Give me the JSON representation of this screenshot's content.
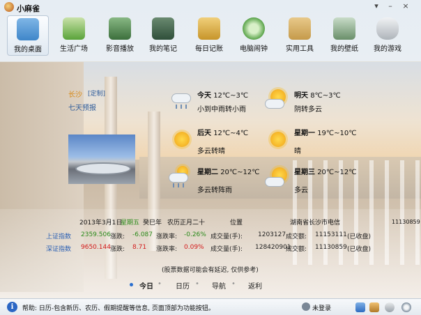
{
  "app": {
    "title": "小麻雀"
  },
  "window_buttons": [
    "▾",
    "–",
    "×"
  ],
  "toolbar": [
    {
      "label": "我的桌面",
      "icon": "house-icon",
      "color": "#3f86c9",
      "active": true
    },
    {
      "label": "生活广场",
      "icon": "village-icon",
      "color": "#5aa33a"
    },
    {
      "label": "影音播放",
      "icon": "film-reel-icon",
      "color": "#3c6f3c"
    },
    {
      "label": "我的笔记",
      "icon": "notebook-icon",
      "color": "#2f4f3a"
    },
    {
      "label": "每日记账",
      "icon": "ledger-dollar-icon",
      "color": "#c7952a"
    },
    {
      "label": "电脑闹钟",
      "icon": "alarm-clock-icon",
      "color": "#4a9a3a"
    },
    {
      "label": "实用工具",
      "icon": "toolbox-icon",
      "color": "#c59a4a"
    },
    {
      "label": "我的壁纸",
      "icon": "wallpaper-icon",
      "color": "#6a8f6a"
    },
    {
      "label": "我的游戏",
      "icon": "gamepad-icon",
      "color": "#aeb4ba"
    }
  ],
  "weather": {
    "city": "长沙",
    "customize": "[定制]",
    "seven_day": "七天预报",
    "forecasts": [
      {
        "day": "今天",
        "temp": "12℃~3℃",
        "desc": "小到中雨转小雨",
        "icon": "rain-icon"
      },
      {
        "day": "明天",
        "temp": "8℃~3℃",
        "desc": "阴转多云",
        "icon": "cloud-sun-icon"
      },
      {
        "day": "后天",
        "temp": "12℃~4℃",
        "desc": "多云转晴",
        "icon": "sun-icon"
      },
      {
        "day": "星期一",
        "temp": "19℃~10℃",
        "desc": "晴",
        "icon": "sun-icon"
      },
      {
        "day": "星期二",
        "temp": "20℃~12℃",
        "desc": "多云转阵雨",
        "icon": "cloud-rain-icon"
      },
      {
        "day": "星期三",
        "temp": "20℃~12℃",
        "desc": "多云",
        "icon": "cloud-sun-icon"
      }
    ]
  },
  "date_row": {
    "date": "2013年3月1日",
    "weekday": "星期五",
    "ganzhi": "癸巳年",
    "lunar": "农历正月二十",
    "location_label": "位置",
    "location": "湖南省长沙市电信",
    "number": "11130859"
  },
  "stocks": [
    {
      "name": "上证指数",
      "value": "2359.506",
      "change_label": "涨跌:",
      "change": "-6.087",
      "rate_label": "涨跌率:",
      "rate": "-0.26%",
      "volume_label": "成交量(手):",
      "volume": "1203127",
      "amount_label": "成交额:",
      "amount": "11153111",
      "status": "(已收盘)"
    },
    {
      "name": "深证指数",
      "value": "9650.144",
      "change_label": "涨跌:",
      "change": "8.71",
      "rate_label": "涨跌率:",
      "rate": "0.09%",
      "volume_label": "成交量(手):",
      "volume": "128420901",
      "amount_label": "成交额:",
      "amount": "11130859",
      "status": "(已收盘)"
    }
  ],
  "notice": "(股票数据可能会有延迟, 仅供参考)",
  "tabs": [
    "今日",
    "日历",
    "导航",
    "返利"
  ],
  "status_bar": {
    "info_glyph": "i",
    "help": "帮助: 日历-包含新历、农历、假期提醒等信息, 页面顶部为功能按钮。",
    "user": "未登录"
  }
}
